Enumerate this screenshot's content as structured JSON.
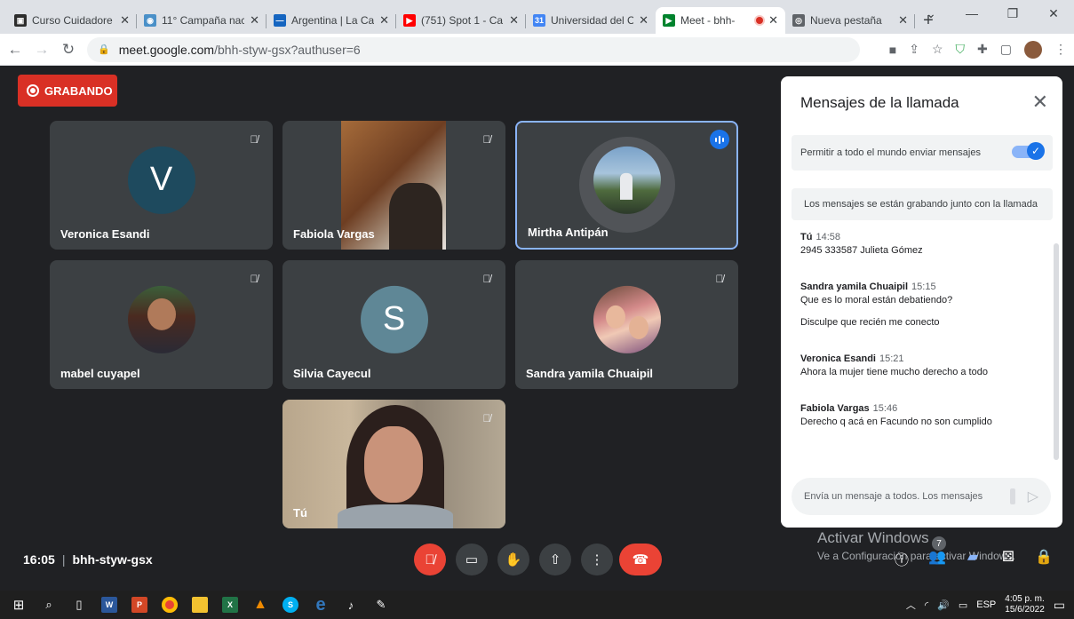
{
  "browser": {
    "tabs": [
      {
        "title": "Curso Cuidadore",
        "favicon_color": "#2d2d2d",
        "favicon": "▣"
      },
      {
        "title": "11° Campaña nac",
        "favicon_color": "#4a90c8",
        "favicon": "◉"
      },
      {
        "title": "Argentina | La Ca",
        "favicon_color": "#1565c0",
        "favicon": "—"
      },
      {
        "title": "(751) Spot 1 - Ca",
        "favicon_color": "#ff0000",
        "favicon": "▶"
      },
      {
        "title": "Universidad del C",
        "favicon_color": "#4285f4",
        "favicon": "31"
      },
      {
        "title": "Meet - bhh-",
        "favicon_color": "#00832d",
        "favicon": "▶",
        "active": true
      },
      {
        "title": "Nueva pestaña",
        "favicon_color": "#5f6368",
        "favicon": "◎"
      }
    ],
    "new_tab": "+",
    "url_host": "meet.google.com",
    "url_path": "/bhh-styw-gsx?authuser=6"
  },
  "meet": {
    "recording_label": "GRABANDO",
    "participants": [
      {
        "name": "Veronica Esandi",
        "initial": "V",
        "avatar_color": "#1e4a5e"
      },
      {
        "name": "Fabiola Vargas"
      },
      {
        "name": "Mirtha Antipán"
      },
      {
        "name": "mabel cuyapel"
      },
      {
        "name": "Silvia Cayecul",
        "initial": "S",
        "avatar_color": "#5f8796"
      },
      {
        "name": "Sandra yamila Chuaipil"
      },
      {
        "name": "Tú"
      }
    ],
    "time": "16:05",
    "meeting_code": "bhh-styw-gsx",
    "participant_count": "7"
  },
  "chat": {
    "title": "Mensajes de la llamada",
    "allow_label": "Permitir a todo el mundo enviar mensajes",
    "recording_note": "Los mensajes se están grabando junto con la llamada",
    "messages": [
      {
        "sender": "Tú",
        "time": "14:58",
        "lines": [
          "2945 333587 Julieta Gómez"
        ]
      },
      {
        "sender": "Sandra yamila Chuaipil",
        "time": "15:15",
        "lines": [
          "Que es lo moral están debatiendo?",
          "Disculpe que recién me conecto"
        ]
      },
      {
        "sender": "Veronica Esandi",
        "time": "15:21",
        "lines": [
          "Ahora la mujer tiene mucho  derecho a todo"
        ]
      },
      {
        "sender": "Fabiola Vargas",
        "time": "15:46",
        "lines": [
          "Derecho q acá en Facundo no son cumplido"
        ]
      }
    ],
    "input_placeholder": "Envía un mensaje a todos. Los mensajes"
  },
  "watermark": {
    "line1": "Activar Windows",
    "line2": "Ve a Configuración para activar Windows."
  },
  "taskbar": {
    "lang": "ESP",
    "clock_time": "4:05 p. m.",
    "clock_date": "15/6/2022"
  }
}
